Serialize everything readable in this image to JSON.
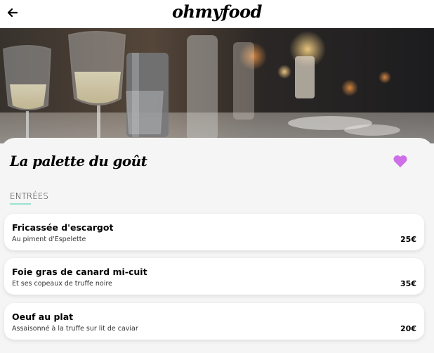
{
  "header": {
    "logo": "ohmyfood",
    "back_icon": "arrow-left-icon"
  },
  "hero": {
    "image": "restaurant-table-photo"
  },
  "restaurant": {
    "name": "La palette du goût",
    "favorite_icon": "heart-icon",
    "favorite_color": "#cf6fe8"
  },
  "menu": {
    "section": "ENTRÉES",
    "accent_color": "#99e2d0",
    "items": [
      {
        "name": "Fricassée d'escargot",
        "description": "Au piment d'Espelette",
        "price": "25€"
      },
      {
        "name": "Foie gras de canard mi-cuit",
        "description": "Et ses copeaux de truffe noire",
        "price": "35€"
      },
      {
        "name": "Oeuf au plat",
        "description": "Assaisonné à la truffe sur lit de caviar",
        "price": "20€"
      }
    ]
  }
}
